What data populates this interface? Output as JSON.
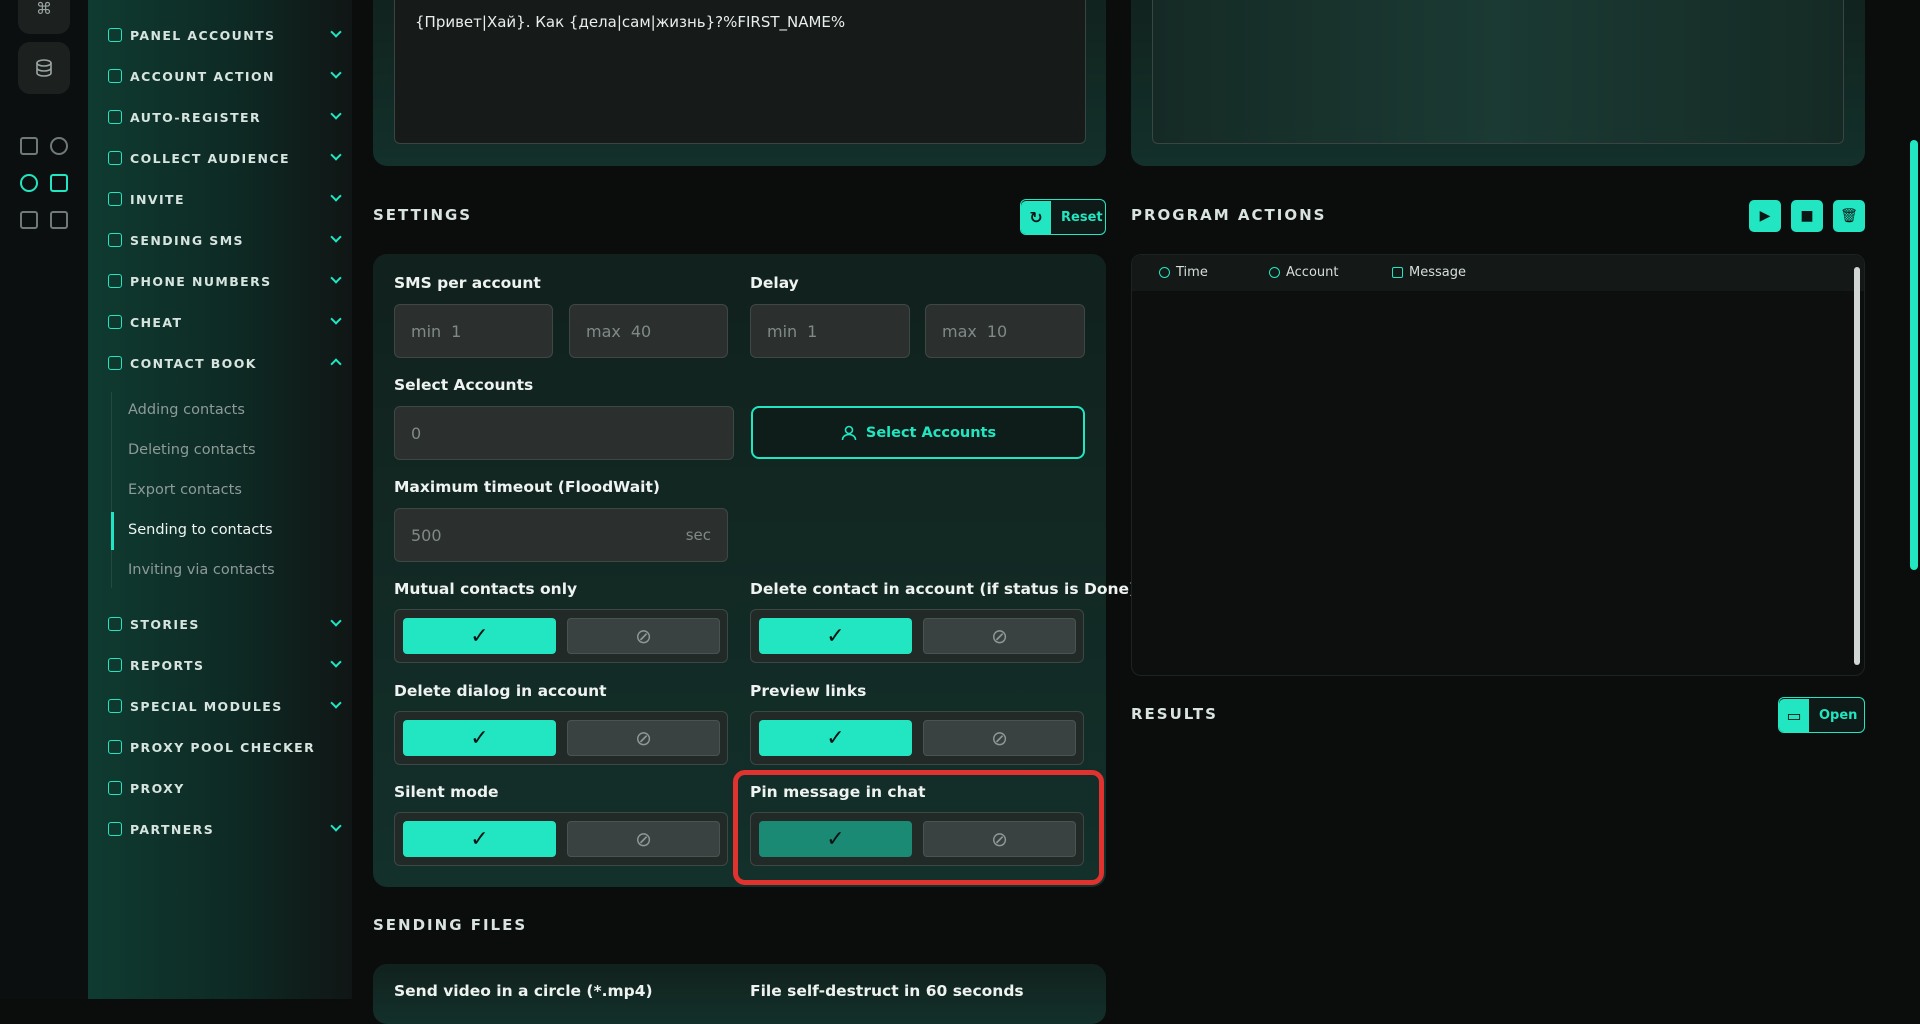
{
  "sidebar": {
    "nav": [
      {
        "label": "PANEL ACCOUNTS"
      },
      {
        "label": "ACCOUNT ACTION"
      },
      {
        "label": "AUTO-REGISTER"
      },
      {
        "label": "COLLECT AUDIENCE"
      },
      {
        "label": "INVITE"
      },
      {
        "label": "SENDING SMS"
      },
      {
        "label": "PHONE NUMBERS"
      },
      {
        "label": "CHEAT"
      },
      {
        "label": "CONTACT BOOK"
      },
      {
        "label": "STORIES"
      },
      {
        "label": "REPORTS"
      },
      {
        "label": "SPECIAL MODULES"
      },
      {
        "label": "PROXY POOL CHECKER"
      },
      {
        "label": "PROXY"
      },
      {
        "label": "PARTNERS"
      }
    ],
    "contact_book_items": [
      "Adding contacts",
      "Deleting contacts",
      "Export contacts",
      "Sending to contacts",
      "Inviting via contacts"
    ]
  },
  "message_text": "{Привет|Хай}. Как {дела|сам|жизнь}?%FIRST_NAME%",
  "settings": {
    "title": "SETTINGS",
    "reset_label": "Reset",
    "sms_per_account": {
      "label": "SMS per account",
      "min_prefix": "min",
      "min_value": "1",
      "max_prefix": "max",
      "max_value": "40"
    },
    "delay": {
      "label": "Delay",
      "min_prefix": "min",
      "min_value": "1",
      "max_prefix": "max",
      "max_value": "10"
    },
    "select_accounts": {
      "label": "Select Accounts",
      "value": "0",
      "button_label": "Select Accounts"
    },
    "timeout": {
      "label": "Maximum timeout (FloodWait)",
      "value": "500",
      "unit": "sec"
    },
    "toggles": {
      "mutual_contacts": "Mutual contacts only",
      "delete_contact": "Delete contact in account (if status is Done)",
      "delete_dialog": "Delete dialog in account",
      "preview_links": "Preview links",
      "silent_mode": "Silent mode",
      "pin_message": "Pin message in chat"
    }
  },
  "program_actions": {
    "title": "PROGRAM ACTIONS",
    "columns": {
      "time": "Time",
      "account": "Account",
      "message": "Message"
    }
  },
  "results": {
    "title": "RESULTS",
    "open_label": "Open"
  },
  "sending_files": {
    "title": "SENDING FILES",
    "video_label": "Send video in a circle (*.mp4)",
    "self_destruct_label": "File self-destruct in 60 seconds"
  },
  "colors": {
    "accent": "#21e6c1",
    "highlight": "#e0322f"
  }
}
